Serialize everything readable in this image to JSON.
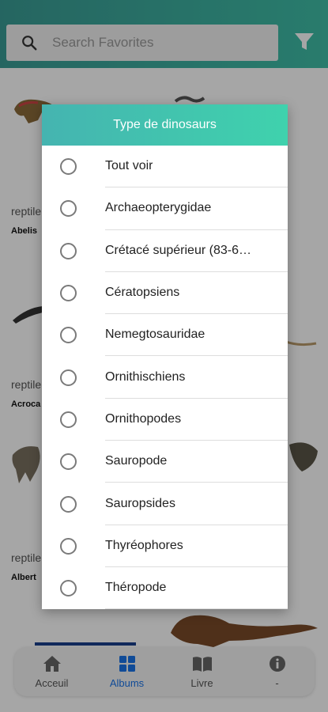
{
  "search": {
    "placeholder": "Search Favorites"
  },
  "cards": [
    {
      "label": "reptile",
      "name": "Abelis"
    },
    {
      "label": "reptile",
      "name": "Acroca"
    },
    {
      "label": "reptile",
      "name": "Albert"
    }
  ],
  "dialog": {
    "title": "Type de dinosaurs",
    "options": [
      "Tout voir",
      "Archaeopterygidae",
      "Crétacé supérieur (83-6…",
      "Cératopsiens",
      "Nemegtosauridae",
      "Ornithischiens",
      "Ornithopodes",
      "Sauropode",
      "Sauropsides",
      "Thyréophores",
      "Théropode"
    ]
  },
  "nav": {
    "home": "Acceuil",
    "albums": "Albums",
    "book": "Livre",
    "info": "-"
  },
  "colors": {
    "topbar": "#3fbfa8",
    "dialog_header": "#3fd2ad",
    "nav_active": "#1a73e8"
  }
}
